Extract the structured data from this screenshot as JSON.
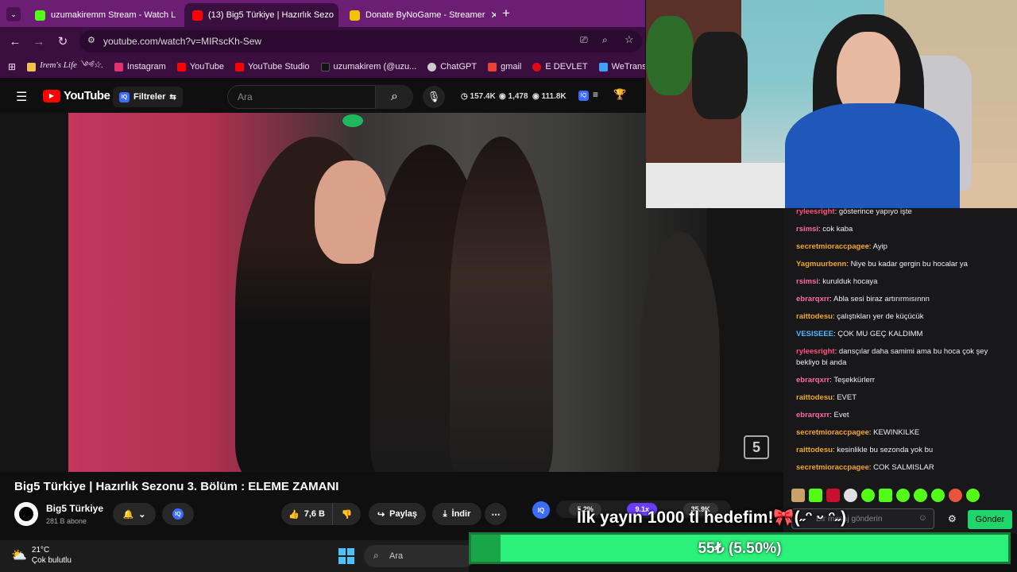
{
  "browser": {
    "tabs": [
      {
        "title": "uzumakiremm Stream - Watch L",
        "favicon_color": "#53fc18",
        "active": false
      },
      {
        "title": "(13) Big5 Türkiye | Hazırlık Sezo",
        "favicon_color": "#ff0000",
        "active": true
      },
      {
        "title": "Donate ByNoGame - Streamer",
        "favicon_color": "#f5c400",
        "active": false
      }
    ],
    "url": "youtube.com/watch?v=MIRscKh-Sew",
    "bookmarks": [
      {
        "label": "Irem's Life ༺☆.",
        "color": "#f2c14e"
      },
      {
        "label": "Instagram",
        "color": "#e1306c"
      },
      {
        "label": "YouTube",
        "color": "#ff0000"
      },
      {
        "label": "YouTube Studio",
        "color": "#ff0000"
      },
      {
        "label": "uzumakirem (@uzu...",
        "color": "#111111"
      },
      {
        "label": "ChatGPT",
        "color": "#cccccc"
      },
      {
        "label": "gmail",
        "color": "#ea4335"
      },
      {
        "label": "E DEVLET",
        "color": "#e30a17"
      },
      {
        "label": "WeTransfe",
        "color": "#409fff"
      }
    ]
  },
  "youtube": {
    "logo": "YouTube",
    "logo_region": "TR",
    "filters_label": "Filtreler",
    "search_placeholder": "Ara",
    "stats": {
      "views": "157.4K",
      "watching": "1,478",
      "subs": "111.8K"
    },
    "video_title": "Big5 Türkiye | Hazırlık Sezonu 3. Bölüm : ELEME ZAMANI",
    "channel_name": "Big5 Türkiye",
    "channel_subs": "281 B abone",
    "like_count": "7,6 B",
    "share_label": "Paylaş",
    "download_label": "İndir",
    "channel_badge": "5",
    "bottom_stats": [
      "5.2%",
      "9.1x",
      "35.9K"
    ]
  },
  "chat": {
    "messages": [
      {
        "user": "ryleesright",
        "color": "#ff4f7b",
        "text": "gösterince yapıyo işte"
      },
      {
        "user": "rsimsi",
        "color": "#ff6b9d",
        "text": "cok kaba"
      },
      {
        "user": "secretmioraccpagee",
        "color": "#f5a623",
        "text": "Ayip"
      },
      {
        "user": "Yagmuurbenn",
        "color": "#f5a623",
        "text": "Niye bu kadar gergin bu hocalar ya"
      },
      {
        "user": "rsimsi",
        "color": "#ff6b9d",
        "text": "kurulduk hocaya"
      },
      {
        "user": "ebrarqxrr",
        "color": "#ff6b9d",
        "text": "Abla sesi biraz artırırmısınnn"
      },
      {
        "user": "raittodesu",
        "color": "#f5a623",
        "text": "çalıştıkları yer de küçücük"
      },
      {
        "user": "VESISEEE",
        "color": "#53b8ff",
        "text": "ÇOK MU GEÇ KALDIMM"
      },
      {
        "user": "ryleesright",
        "color": "#ff4f7b",
        "text": "dansçılar daha samimi ama bu hoca çok şey bekliyo bi anda"
      },
      {
        "user": "ebrarqxrr",
        "color": "#ff6b9d",
        "text": "Teşekkürlerr"
      },
      {
        "user": "raittodesu",
        "color": "#f5a623",
        "text": "EVET"
      },
      {
        "user": "ebrarqxrr",
        "color": "#ff6b9d",
        "text": "Evet"
      },
      {
        "user": "secretmioraccpagee",
        "color": "#f5a623",
        "text": "KEWINKILKE"
      },
      {
        "user": "raittodesu",
        "color": "#f5a623",
        "text": "kesinlikle bu sezonda yok bu"
      },
      {
        "user": "secretmioraccpagee",
        "color": "#f5a623",
        "text": "COK SALMISLAR"
      }
    ],
    "input_placeholder": "Bir mesaj gönderin",
    "send_label": "Gönder"
  },
  "donation": {
    "goal_text": "İlk yayın 1000 tl hedefim!🎀(˶ᵔ ᵕ ᵔ˶)",
    "progress_label": "55₺ (5.50%)",
    "progress_fraction": 0.055
  },
  "taskbar": {
    "temperature": "21°C",
    "weather": "Çok bulutlu",
    "search_label": "Ara"
  }
}
